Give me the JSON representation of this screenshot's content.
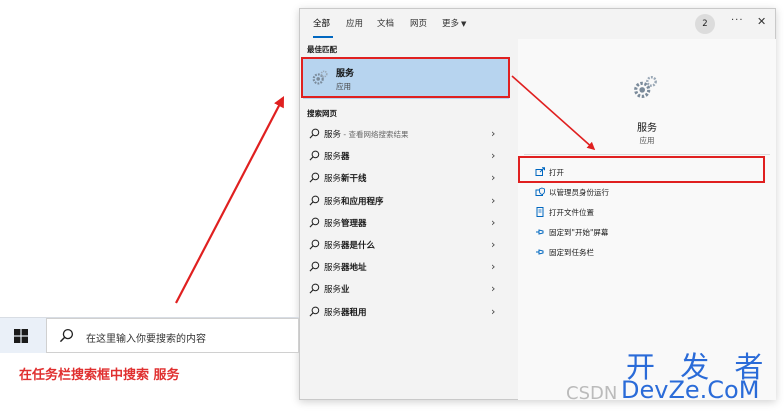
{
  "tabs": [
    {
      "label": "全部",
      "active": true
    },
    {
      "label": "应用",
      "active": false
    },
    {
      "label": "文档",
      "active": false
    },
    {
      "label": "网页",
      "active": false
    },
    {
      "label": "更多",
      "active": false
    }
  ],
  "header": {
    "badge_count": "2",
    "more_icon": "ellipsis-icon",
    "close_icon": "close-icon"
  },
  "best_match": {
    "section_label": "最佳匹配",
    "name": "服务",
    "type": "应用",
    "icon": "gear-icon"
  },
  "web_search": {
    "section_label": "搜索网页",
    "items": [
      {
        "bold": "服务",
        "rest": "",
        "sub": " - 查看网络搜索结果"
      },
      {
        "bold": "服务",
        "rest": "器",
        "sub": ""
      },
      {
        "bold": "服务",
        "rest": "新干线",
        "sub": ""
      },
      {
        "bold": "服务",
        "rest": "和应用程序",
        "sub": ""
      },
      {
        "bold": "服务",
        "rest": "管理器",
        "sub": ""
      },
      {
        "bold": "服务",
        "rest": "器是什么",
        "sub": ""
      },
      {
        "bold": "服务",
        "rest": "器地址",
        "sub": ""
      },
      {
        "bold": "服务",
        "rest": "业",
        "sub": ""
      },
      {
        "bold": "服务",
        "rest": "器租用",
        "sub": ""
      }
    ]
  },
  "detail": {
    "title": "服务",
    "type": "应用",
    "actions": [
      {
        "label": "打开",
        "icon": "open-icon"
      },
      {
        "label": "以管理员身份运行",
        "icon": "run-as-admin-icon"
      },
      {
        "label": "打开文件位置",
        "icon": "file-location-icon"
      },
      {
        "label": "固定到\"开始\"屏幕",
        "icon": "pin-start-icon"
      },
      {
        "label": "固定到任务栏",
        "icon": "pin-taskbar-icon"
      }
    ]
  },
  "taskbar": {
    "search_placeholder": "在这里输入你要搜索的内容",
    "start_icon": "windows-logo-icon"
  },
  "annotation": {
    "caption": "在任务栏搜索框中搜索 服务",
    "color": "#e02020"
  },
  "watermark": {
    "text_cn": "开 发 者",
    "text_site": "DevZe.CoM",
    "text_csdn": "CSDN"
  }
}
